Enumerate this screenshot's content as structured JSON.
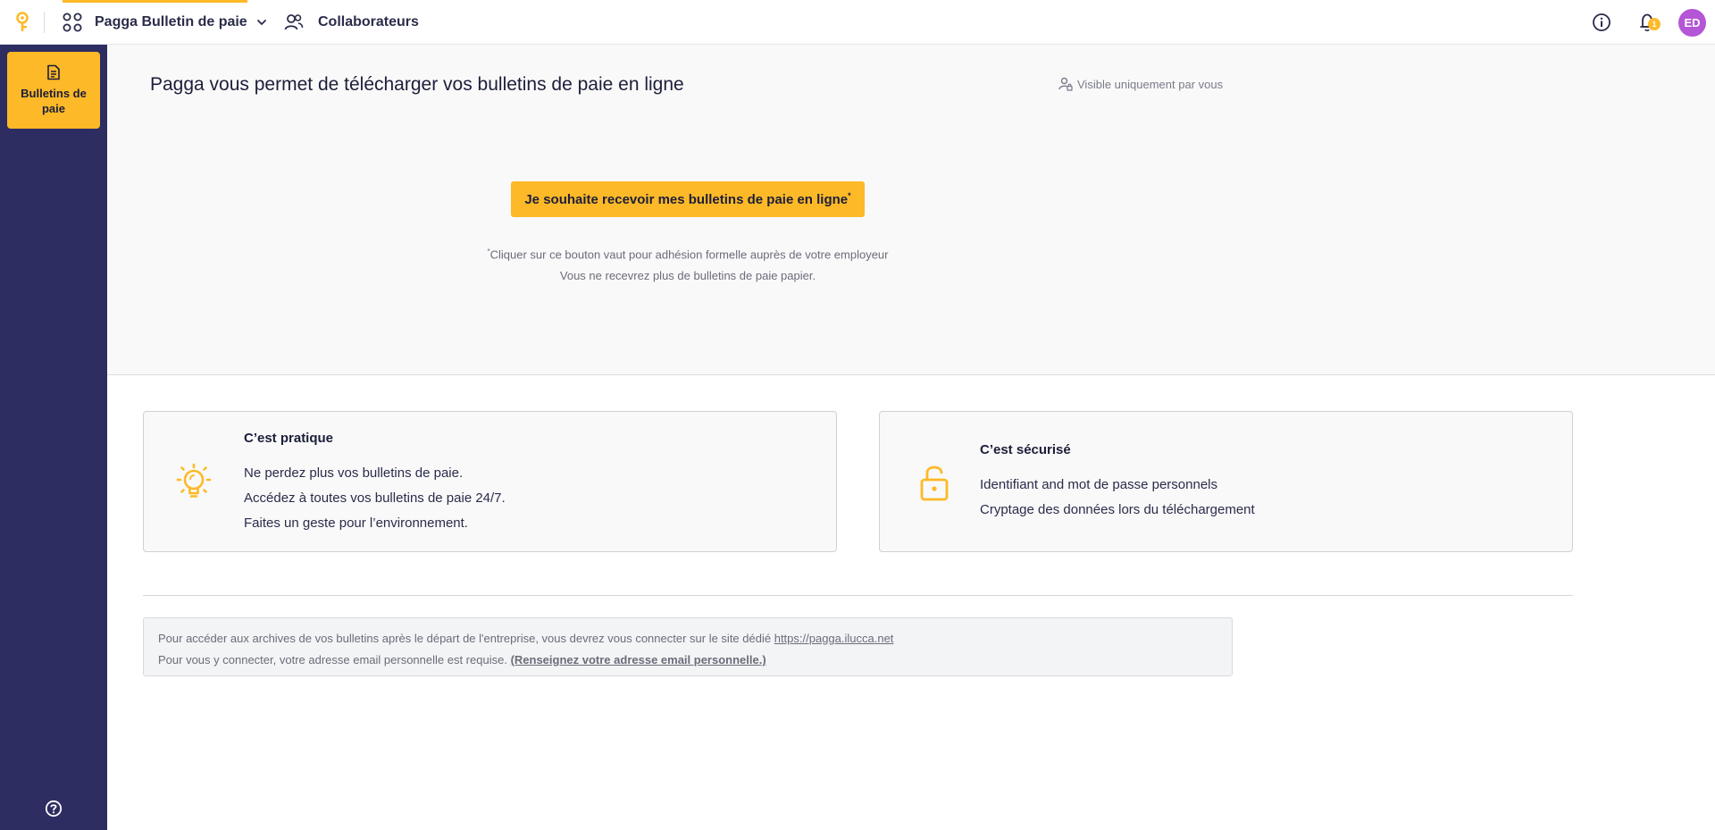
{
  "topbar": {
    "app_name": "Pagga Bulletin de paie",
    "collaborators_label": "Collaborateurs",
    "notifications_count": "1",
    "avatar_initials": "ED"
  },
  "sidebar": {
    "items": [
      {
        "label": "Bulletins de paie",
        "icon": "document-icon"
      }
    ]
  },
  "hero": {
    "title": "Pagga vous permet de télécharger vos bulletins de paie en ligne",
    "visibility_note": "Visible uniquement par vous",
    "cta_label": "Je souhaite recevoir mes bulletins de paie en ligne",
    "cta_sup": "*",
    "note_sup": "*",
    "note_line1": "Cliquer sur ce bouton vaut pour adhésion formelle auprès de votre employeur",
    "note_line2": "Vous ne recevrez plus de bulletins de paie papier."
  },
  "cards": [
    {
      "title": "C’est pratique",
      "icon": "lightbulb-icon",
      "lines": [
        "Ne perdez plus vos bulletins de paie.",
        "Accédez à toutes vos bulletins de paie 24/7.",
        "Faites un geste pour l’environnement."
      ]
    },
    {
      "title": "C’est sécurisé",
      "icon": "padlock-open-icon",
      "lines": [
        "Identifiant and mot de passe personnels",
        "Cryptage des données lors du téléchargement"
      ]
    }
  ],
  "archive": {
    "line1_text": "Pour accéder aux archives de vos bulletins après le départ de l'entreprise, vous devrez vous connecter sur le site dédié",
    "line1_link": "https://pagga.ilucca.net",
    "line2_text": "Pour vous y connecter, votre adresse email personnelle est requise.",
    "line2_link": "(Renseignez votre adresse email personnelle.)"
  },
  "colors": {
    "accent": "#fdb927",
    "sidebar": "#2d2d62",
    "avatar": "#b456d6"
  }
}
